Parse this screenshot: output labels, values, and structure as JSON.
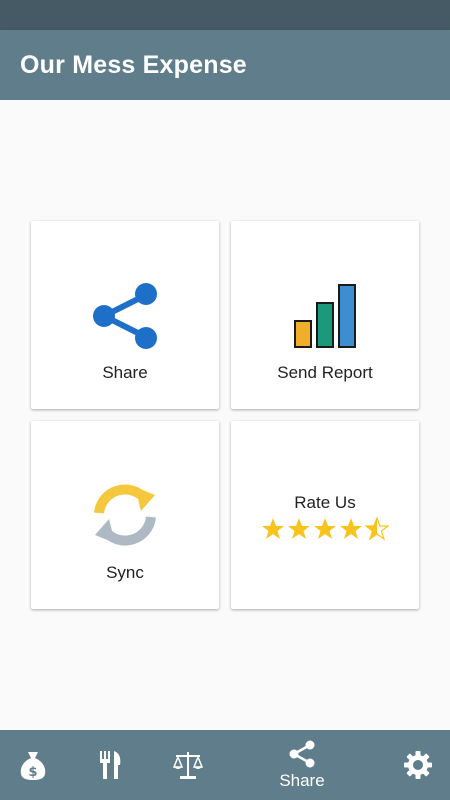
{
  "app": {
    "title": "Our Mess Expense"
  },
  "cards": {
    "share": {
      "label": "Share",
      "icon": "share-icon"
    },
    "send_report": {
      "label": "Send Report",
      "icon": "bar-chart-icon"
    },
    "sync": {
      "label": "Sync",
      "icon": "sync-icon"
    },
    "rate_us": {
      "label": "Rate Us",
      "rating": 4.5,
      "max_rating": 5
    }
  },
  "bottom_nav": {
    "items": [
      {
        "icon": "money-bag-icon"
      },
      {
        "icon": "fork-knife-icon"
      },
      {
        "icon": "balance-scale-icon"
      },
      {
        "icon": "share-icon",
        "label": "Share"
      },
      {
        "icon": "gear-icon"
      }
    ]
  },
  "colors": {
    "status_bar": "#455a64",
    "app_bar": "#607d8b",
    "share_blue": "#1e6fc8",
    "bar_orange": "#f2ad29",
    "bar_green": "#1a9a7a",
    "bar_blue": "#3d8ed0",
    "star_yellow": "#f8c31a",
    "sync_yellow": "#f5c73c",
    "sync_gray": "#aeb9c4"
  }
}
